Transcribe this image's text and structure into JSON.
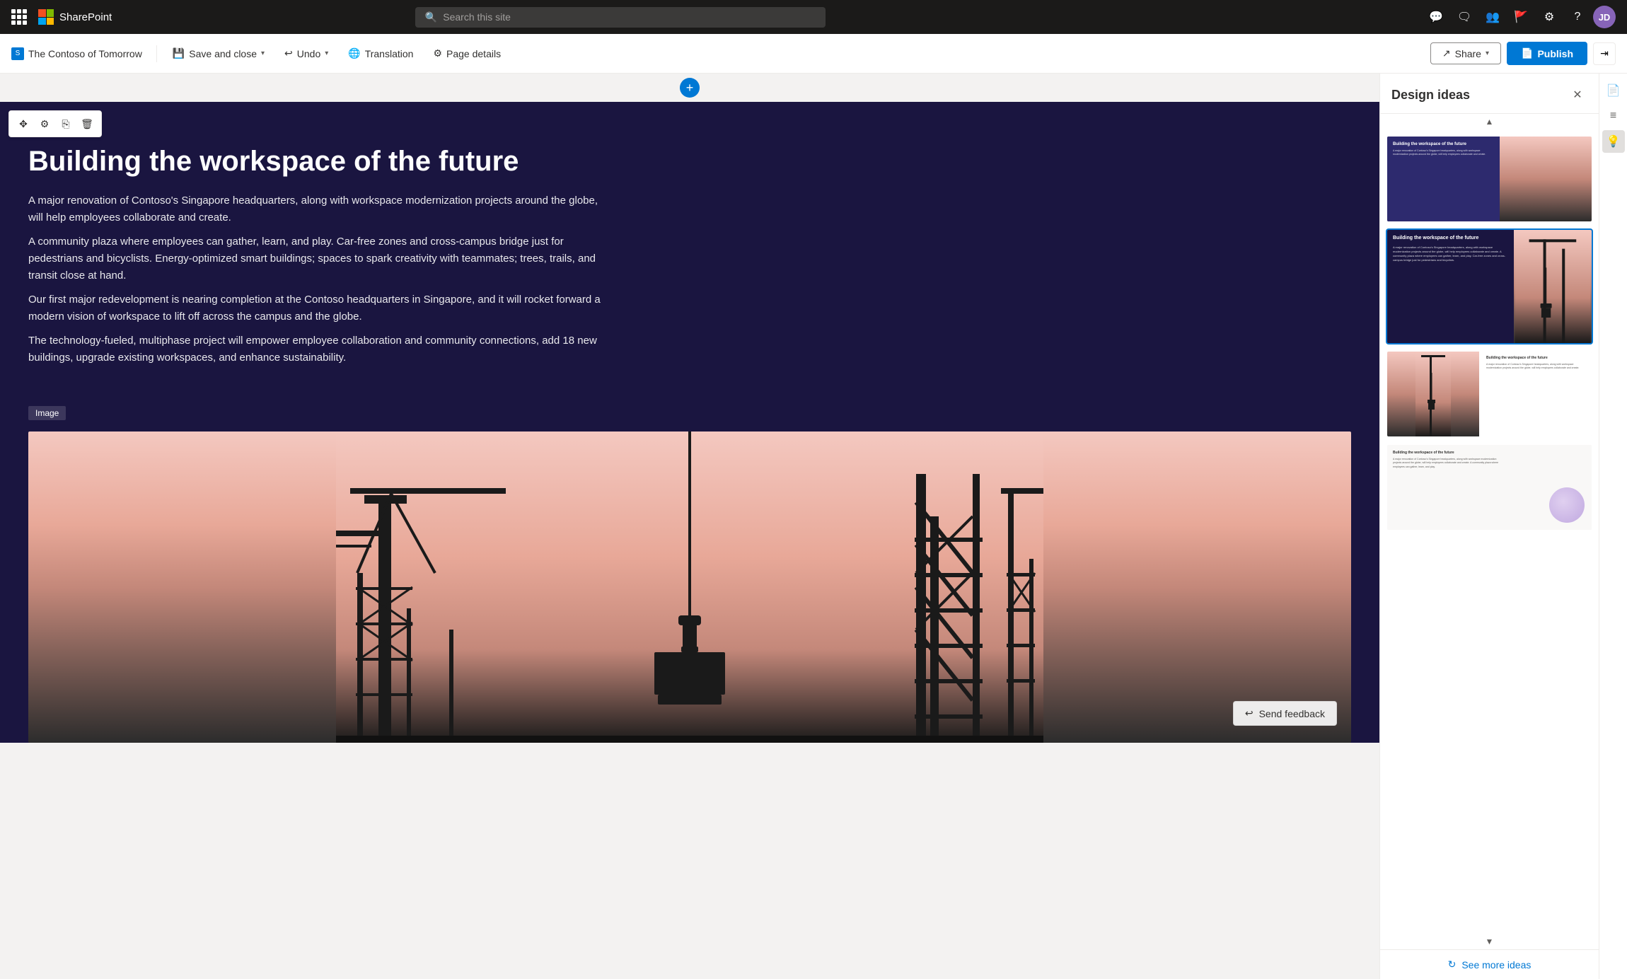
{
  "app": {
    "name": "SharePoint",
    "waffle_label": "Microsoft 365 app launcher"
  },
  "nav": {
    "search_placeholder": "Search this site",
    "icons": [
      "help-icon",
      "comment-icon",
      "people-icon",
      "flag-icon",
      "settings-icon",
      "question-icon"
    ],
    "avatar_initials": "JD"
  },
  "toolbar": {
    "site_name": "The Contoso of Tomorrow",
    "save_close_label": "Save and close",
    "undo_label": "Undo",
    "translation_label": "Translation",
    "page_details_label": "Page details",
    "share_label": "Share",
    "publish_label": "Publish"
  },
  "editor": {
    "add_section_tooltip": "Add a new section",
    "section_tools": [
      "move",
      "edit",
      "duplicate",
      "delete"
    ],
    "hero": {
      "title": "Building the workspace of the future",
      "body_paragraphs": [
        "A major renovation of Contoso's Singapore headquarters, along with workspace modernization projects around the globe, will help employees collaborate and create.",
        "A community plaza where employees can gather, learn, and play. Car-free zones and cross-campus bridge just for pedestrians and bicyclists. Energy-optimized smart buildings; spaces to spark creativity with teammates; trees, trails, and transit close at hand.",
        "Our first major redevelopment is nearing completion at the Contoso headquarters in Singapore, and it will rocket forward a modern vision of workspace to lift off across the campus and the globe.",
        "The technology-fueled, multiphase project will empower employee collaboration and community connections, add 18 new buildings, upgrade existing workspaces, and enhance sustainability."
      ]
    },
    "image_label": "Image",
    "send_feedback_label": "Send feedback"
  },
  "design_panel": {
    "title": "Design ideas",
    "close_label": "Close",
    "templates": [
      {
        "id": 1,
        "type": "split-right-image",
        "selected": false
      },
      {
        "id": 2,
        "type": "dark-overlay-image",
        "selected": true
      },
      {
        "id": 3,
        "type": "side-by-side",
        "selected": false
      },
      {
        "id": 4,
        "type": "minimal-circle",
        "selected": false
      }
    ],
    "see_more_label": "See more ideas"
  }
}
